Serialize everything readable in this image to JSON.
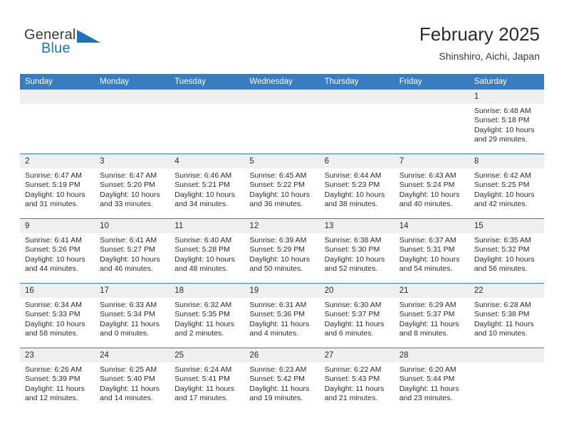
{
  "brand": {
    "name_part1": "General",
    "name_part2": "Blue",
    "triangle_color": "#1b75bb"
  },
  "header": {
    "month_title": "February 2025",
    "location": "Shinshiro, Aichi, Japan"
  },
  "theme": {
    "header_row_color": "#3a7cc0",
    "daynum_band_color": "#efefef",
    "text_color": "#2b2b2b",
    "page_background": "#ffffff"
  },
  "calendar": {
    "weekday_headers": [
      "Sunday",
      "Monday",
      "Tuesday",
      "Wednesday",
      "Thursday",
      "Friday",
      "Saturday"
    ],
    "weeks": [
      [
        {
          "day": "",
          "sunrise": "",
          "sunset": "",
          "daylight": "",
          "empty": true
        },
        {
          "day": "",
          "sunrise": "",
          "sunset": "",
          "daylight": "",
          "empty": true
        },
        {
          "day": "",
          "sunrise": "",
          "sunset": "",
          "daylight": "",
          "empty": true
        },
        {
          "day": "",
          "sunrise": "",
          "sunset": "",
          "daylight": "",
          "empty": true
        },
        {
          "day": "",
          "sunrise": "",
          "sunset": "",
          "daylight": "",
          "empty": true
        },
        {
          "day": "",
          "sunrise": "",
          "sunset": "",
          "daylight": "",
          "empty": true
        },
        {
          "day": "1",
          "sunrise": "Sunrise: 6:48 AM",
          "sunset": "Sunset: 5:18 PM",
          "daylight": "Daylight: 10 hours and 29 minutes.",
          "empty": false
        }
      ],
      [
        {
          "day": "2",
          "sunrise": "Sunrise: 6:47 AM",
          "sunset": "Sunset: 5:19 PM",
          "daylight": "Daylight: 10 hours and 31 minutes.",
          "empty": false
        },
        {
          "day": "3",
          "sunrise": "Sunrise: 6:47 AM",
          "sunset": "Sunset: 5:20 PM",
          "daylight": "Daylight: 10 hours and 33 minutes.",
          "empty": false
        },
        {
          "day": "4",
          "sunrise": "Sunrise: 6:46 AM",
          "sunset": "Sunset: 5:21 PM",
          "daylight": "Daylight: 10 hours and 34 minutes.",
          "empty": false
        },
        {
          "day": "5",
          "sunrise": "Sunrise: 6:45 AM",
          "sunset": "Sunset: 5:22 PM",
          "daylight": "Daylight: 10 hours and 36 minutes.",
          "empty": false
        },
        {
          "day": "6",
          "sunrise": "Sunrise: 6:44 AM",
          "sunset": "Sunset: 5:23 PM",
          "daylight": "Daylight: 10 hours and 38 minutes.",
          "empty": false
        },
        {
          "day": "7",
          "sunrise": "Sunrise: 6:43 AM",
          "sunset": "Sunset: 5:24 PM",
          "daylight": "Daylight: 10 hours and 40 minutes.",
          "empty": false
        },
        {
          "day": "8",
          "sunrise": "Sunrise: 6:42 AM",
          "sunset": "Sunset: 5:25 PM",
          "daylight": "Daylight: 10 hours and 42 minutes.",
          "empty": false
        }
      ],
      [
        {
          "day": "9",
          "sunrise": "Sunrise: 6:41 AM",
          "sunset": "Sunset: 5:26 PM",
          "daylight": "Daylight: 10 hours and 44 minutes.",
          "empty": false
        },
        {
          "day": "10",
          "sunrise": "Sunrise: 6:41 AM",
          "sunset": "Sunset: 5:27 PM",
          "daylight": "Daylight: 10 hours and 46 minutes.",
          "empty": false
        },
        {
          "day": "11",
          "sunrise": "Sunrise: 6:40 AM",
          "sunset": "Sunset: 5:28 PM",
          "daylight": "Daylight: 10 hours and 48 minutes.",
          "empty": false
        },
        {
          "day": "12",
          "sunrise": "Sunrise: 6:39 AM",
          "sunset": "Sunset: 5:29 PM",
          "daylight": "Daylight: 10 hours and 50 minutes.",
          "empty": false
        },
        {
          "day": "13",
          "sunrise": "Sunrise: 6:38 AM",
          "sunset": "Sunset: 5:30 PM",
          "daylight": "Daylight: 10 hours and 52 minutes.",
          "empty": false
        },
        {
          "day": "14",
          "sunrise": "Sunrise: 6:37 AM",
          "sunset": "Sunset: 5:31 PM",
          "daylight": "Daylight: 10 hours and 54 minutes.",
          "empty": false
        },
        {
          "day": "15",
          "sunrise": "Sunrise: 6:35 AM",
          "sunset": "Sunset: 5:32 PM",
          "daylight": "Daylight: 10 hours and 56 minutes.",
          "empty": false
        }
      ],
      [
        {
          "day": "16",
          "sunrise": "Sunrise: 6:34 AM",
          "sunset": "Sunset: 5:33 PM",
          "daylight": "Daylight: 10 hours and 58 minutes.",
          "empty": false
        },
        {
          "day": "17",
          "sunrise": "Sunrise: 6:33 AM",
          "sunset": "Sunset: 5:34 PM",
          "daylight": "Daylight: 11 hours and 0 minutes.",
          "empty": false
        },
        {
          "day": "18",
          "sunrise": "Sunrise: 6:32 AM",
          "sunset": "Sunset: 5:35 PM",
          "daylight": "Daylight: 11 hours and 2 minutes.",
          "empty": false
        },
        {
          "day": "19",
          "sunrise": "Sunrise: 6:31 AM",
          "sunset": "Sunset: 5:36 PM",
          "daylight": "Daylight: 11 hours and 4 minutes.",
          "empty": false
        },
        {
          "day": "20",
          "sunrise": "Sunrise: 6:30 AM",
          "sunset": "Sunset: 5:37 PM",
          "daylight": "Daylight: 11 hours and 6 minutes.",
          "empty": false
        },
        {
          "day": "21",
          "sunrise": "Sunrise: 6:29 AM",
          "sunset": "Sunset: 5:37 PM",
          "daylight": "Daylight: 11 hours and 8 minutes.",
          "empty": false
        },
        {
          "day": "22",
          "sunrise": "Sunrise: 6:28 AM",
          "sunset": "Sunset: 5:38 PM",
          "daylight": "Daylight: 11 hours and 10 minutes.",
          "empty": false
        }
      ],
      [
        {
          "day": "23",
          "sunrise": "Sunrise: 6:26 AM",
          "sunset": "Sunset: 5:39 PM",
          "daylight": "Daylight: 11 hours and 12 minutes.",
          "empty": false
        },
        {
          "day": "24",
          "sunrise": "Sunrise: 6:25 AM",
          "sunset": "Sunset: 5:40 PM",
          "daylight": "Daylight: 11 hours and 14 minutes.",
          "empty": false
        },
        {
          "day": "25",
          "sunrise": "Sunrise: 6:24 AM",
          "sunset": "Sunset: 5:41 PM",
          "daylight": "Daylight: 11 hours and 17 minutes.",
          "empty": false
        },
        {
          "day": "26",
          "sunrise": "Sunrise: 6:23 AM",
          "sunset": "Sunset: 5:42 PM",
          "daylight": "Daylight: 11 hours and 19 minutes.",
          "empty": false
        },
        {
          "day": "27",
          "sunrise": "Sunrise: 6:22 AM",
          "sunset": "Sunset: 5:43 PM",
          "daylight": "Daylight: 11 hours and 21 minutes.",
          "empty": false
        },
        {
          "day": "28",
          "sunrise": "Sunrise: 6:20 AM",
          "sunset": "Sunset: 5:44 PM",
          "daylight": "Daylight: 11 hours and 23 minutes.",
          "empty": false
        },
        {
          "day": "",
          "sunrise": "",
          "sunset": "",
          "daylight": "",
          "empty": true
        }
      ]
    ]
  }
}
